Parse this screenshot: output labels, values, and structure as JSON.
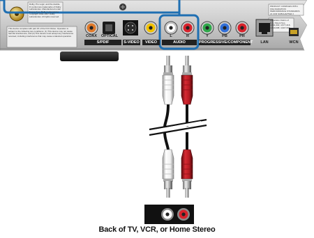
{
  "panel": {
    "spdif_coax": "COAX",
    "spdif_optical": "OPTICAL",
    "spdif_group": "S/PDIF",
    "svideo": "S-VIDEO",
    "video": "VIDEO",
    "audio_l": "L",
    "audio_r": "R",
    "audio_group": "AUDIO",
    "comp_y": "Y",
    "comp_pb": "PB",
    "comp_pr": "PR",
    "comp_group": "PROGRESSIVE/COMPONENT",
    "lan": "LAN",
    "wcn": "WCN",
    "compliance_label": "PRODUCT COMPLIES WITH FDA RADIATION PERFORMANCE STANDARDS 21 CFR SUBCHAPTER J",
    "fcc_notice": "This device complies with part 15 of the FCC Rules. Operation is subject to the following two conditions: (1) This device may not cause harmful interference, and (2) This device must accept any interference received, including interference that may cause undesired operation.",
    "dolby_notice": "Dolby, Pro Logic, and the double-D symbol are trademarks of Dolby Laboratories. Manufactured under license from Dolby Laboratories. Copyright 1992-1997 Dolby Laboratories. All rights reserved.",
    "patent_notice": "Apparatus Claims of U.S. Patent Nos. 4,631,603; 4,577,216; 4,819,098; 4,907,093"
  },
  "jack_colors": {
    "coax": "#e07a2a",
    "video": "#f2c200",
    "left": "#ffffff",
    "right": "#d8222b",
    "y": "#2fa84a",
    "pb": "#2f6ed8",
    "pr": "#d8222b",
    "highlight": "#1f6fb2"
  },
  "caption": "Back of TV, VCR, or Home Stereo"
}
